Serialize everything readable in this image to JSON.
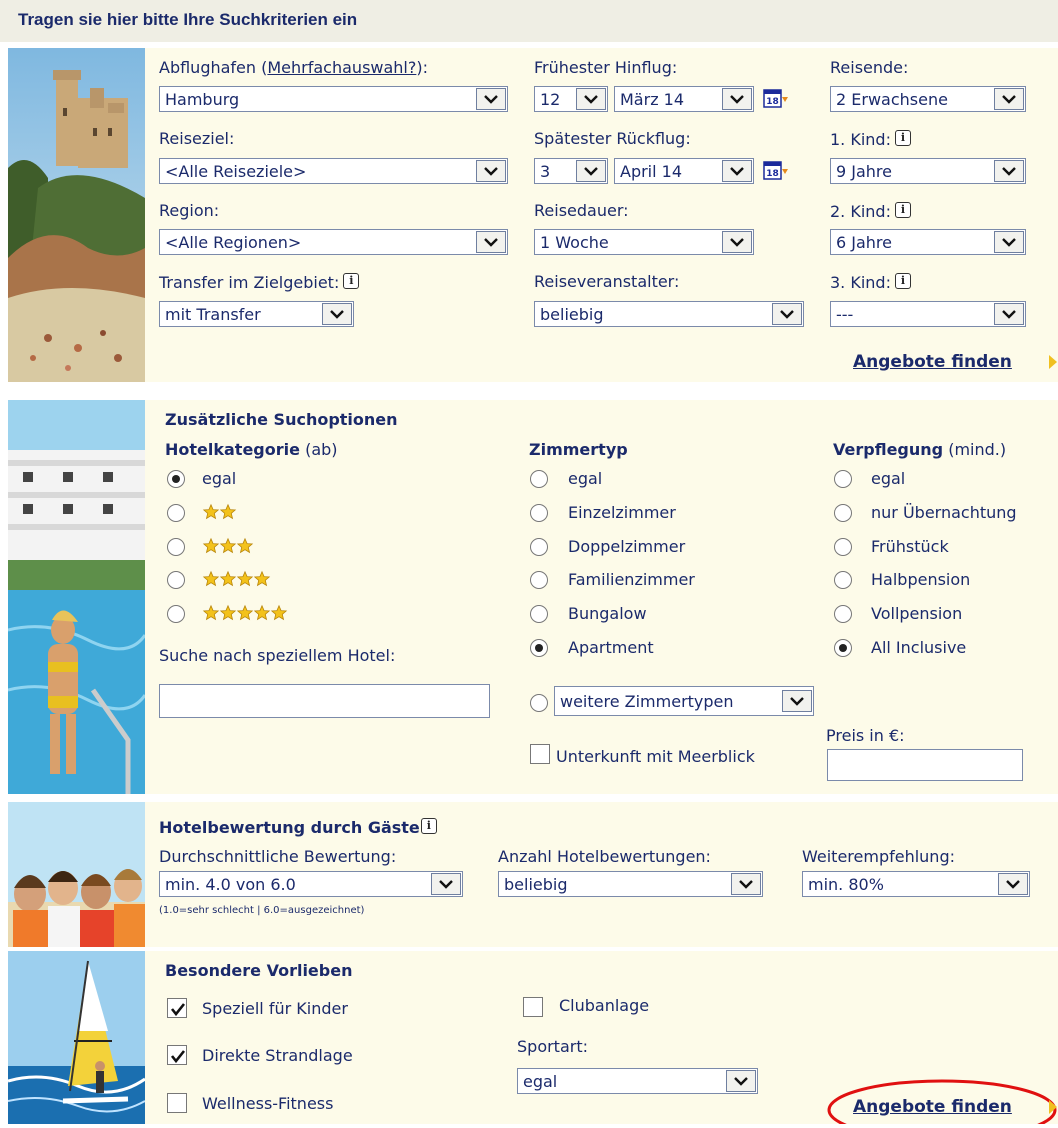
{
  "header": {
    "title": "Tragen sie hier bitte Ihre Suchkriterien ein"
  },
  "search": {
    "departure_label_prefix": "Abflughafen (",
    "departure_label_link": "Mehrfachauswahl?",
    "departure_label_suffix": "):",
    "departure_value": "Hamburg",
    "destination_label": "Reiseziel:",
    "destination_value": "<Alle Reiseziele>",
    "region_label": "Region:",
    "region_value": "<Alle Regionen>",
    "transfer_label": "Transfer im Zielgebiet:",
    "transfer_value": "mit Transfer",
    "earliest_label": "Frühester Hinflug:",
    "earliest_day": "12",
    "earliest_month": "März 14",
    "latest_label": "Spätester Rückflug:",
    "latest_day": "3",
    "latest_month": "April 14",
    "duration_label": "Reisedauer:",
    "duration_value": "1 Woche",
    "operator_label": "Reiseveranstalter:",
    "operator_value": "beliebig",
    "travelers_label": "Reisende:",
    "travelers_value": "2 Erwachsene",
    "child1_label": "1. Kind:",
    "child1_value": "9 Jahre",
    "child2_label": "2. Kind:",
    "child2_value": "6 Jahre",
    "child3_label": "3. Kind:",
    "child3_value": "---",
    "calendar_badge": "18",
    "info_glyph": "i",
    "find_button": "Angebote finden"
  },
  "options": {
    "title": "Zusätzliche Suchoptionen",
    "hotel_category_title": "Hotelkategorie",
    "hotel_category_suffix": "(ab)",
    "hotel_category_any": "egal",
    "hotel_category_selected": "egal",
    "stars": [
      2,
      3,
      4,
      5
    ],
    "room_type_title": "Zimmertyp",
    "room_types": [
      "egal",
      "Einzelzimmer",
      "Doppelzimmer",
      "Familienzimmer",
      "Bungalow",
      "Apartment"
    ],
    "room_type_selected": "Apartment",
    "more_room_types": "weitere Zimmertypen",
    "sea_view_label": "Unterkunft mit Meerblick",
    "sea_view_checked": false,
    "board_title": "Verpflegung",
    "board_suffix": "(mind.)",
    "boards": [
      "egal",
      "nur Übernachtung",
      "Frühstück",
      "Halbpension",
      "Vollpension",
      "All Inclusive"
    ],
    "board_selected": "All Inclusive",
    "hotel_search_label": "Suche nach speziellem Hotel:",
    "hotel_search_value": "",
    "price_label": "Preis in €:",
    "price_value": ""
  },
  "rating": {
    "title": "Hotelbewertung durch Gäste",
    "avg_label": "Durchschnittliche Bewertung:",
    "avg_value": "min. 4.0 von 6.0",
    "avg_hint": "(1.0=sehr schlecht | 6.0=ausgezeichnet)",
    "count_label": "Anzahl Hotelbewertungen:",
    "count_value": "beliebig",
    "recommend_label": "Weiterempfehlung:",
    "recommend_value": "min. 80%"
  },
  "prefs": {
    "title": "Besondere Vorlieben",
    "kids_label": "Speziell für Kinder",
    "kids_checked": true,
    "beach_label": "Direkte Strandlage",
    "beach_checked": true,
    "wellness_label": "Wellness-Fitness",
    "wellness_checked": false,
    "club_label": "Clubanlage",
    "club_checked": false,
    "sport_label": "Sportart:",
    "sport_value": "egal",
    "find_button": "Angebote finden"
  },
  "colors": {
    "text": "#1b2a6b",
    "panel": "#fdfbe9",
    "header": "#efeee4",
    "arrow": "#f0c020",
    "highlight": "#e01010",
    "star": "#f3c21b"
  }
}
